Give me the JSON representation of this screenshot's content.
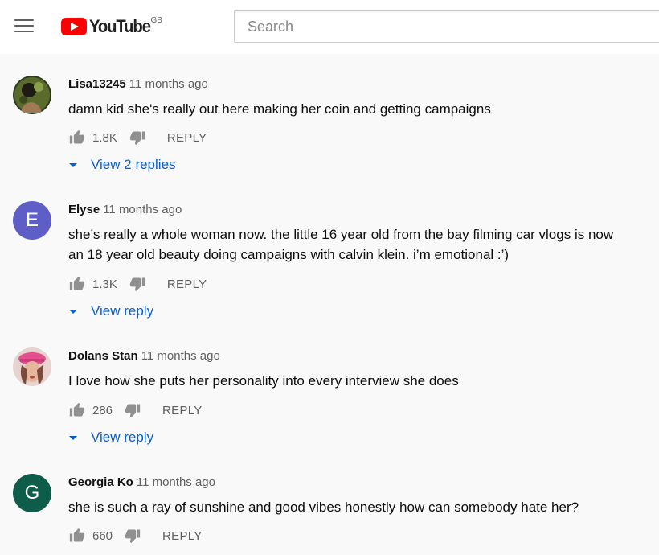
{
  "header": {
    "logo_text": "YouTube",
    "region": "GB",
    "search_placeholder": "Search"
  },
  "colors": {
    "brand_red": "#ff0000",
    "link_blue": "#065fd4",
    "avatar_elyse": "#5f5ec7",
    "avatar_georgia": "#0e5c4a"
  },
  "comments": [
    {
      "author": "Lisa13245",
      "time": "11 months ago",
      "text": "damn kid she's really out here making her coin and getting campaigns",
      "likes": "1.8K",
      "reply_label": "REPLY",
      "view_replies": "View 2 replies",
      "avatar_type": "photo"
    },
    {
      "author": "Elyse",
      "time": "11 months ago",
      "text": "she’s really a whole woman now. the little 16 year old from the bay filming car vlogs is now an 18 year old beauty doing campaigns with calvin klein. i’m emotional :’)",
      "likes": "1.3K",
      "reply_label": "REPLY",
      "view_replies": "View reply",
      "avatar_letter": "E"
    },
    {
      "author": "Dolans Stan",
      "time": "11 months ago",
      "text": "I love how she puts her personality into every interview she does",
      "likes": "286",
      "reply_label": "REPLY",
      "view_replies": "View reply",
      "avatar_type": "photo"
    },
    {
      "author": "Georgia Ko",
      "time": "11 months ago",
      "text": "she is such a ray of sunshine and good vibes honestly how can somebody hate her?",
      "likes": "660",
      "reply_label": "REPLY",
      "avatar_letter": "G"
    }
  ]
}
